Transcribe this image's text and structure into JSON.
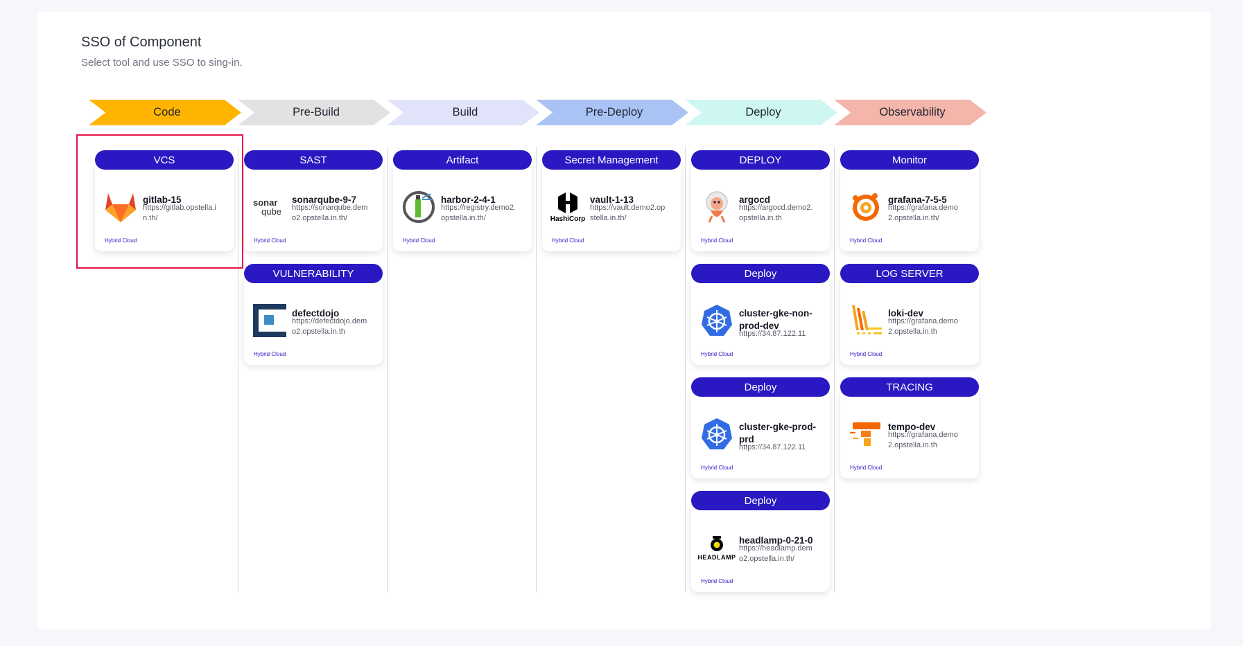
{
  "page": {
    "title": "SSO of Component",
    "subtitle": "Select tool and use SSO to sing-in."
  },
  "stages": [
    {
      "label": "Code",
      "color": "#ffb400"
    },
    {
      "label": "Pre-Build",
      "color": "#e2e2e2"
    },
    {
      "label": "Build",
      "color": "#e1e3fb"
    },
    {
      "label": "Pre-Deploy",
      "color": "#a9c3f5"
    },
    {
      "label": "Deploy",
      "color": "#cff7f2"
    },
    {
      "label": "Observability",
      "color": "#f4b5aa"
    }
  ],
  "colors": {
    "pill": "#2a19c2",
    "highlight": "#e5134b",
    "badge": "#2a19c2"
  },
  "columns": [
    {
      "groups": [
        {
          "category": "VCS",
          "tool": {
            "name": "gitlab-15",
            "url": "https://gitlab.opstella.in.th/",
            "badge": "Hybrid Cloud",
            "icon": "gitlab-icon"
          }
        }
      ]
    },
    {
      "groups": [
        {
          "category": "SAST",
          "tool": {
            "name": "sonarqube-9-7",
            "url": "https://sonarqube.demo2.opstella.in.th/",
            "badge": "Hybrid Cloud",
            "icon": "sonarqube-icon",
            "logo_text_1": "sonar",
            "logo_text_2": "qube"
          }
        },
        {
          "category": "VULNERABILITY",
          "tool": {
            "name": "defectdojo",
            "url": "https://defectdojo.demo2.opstella.in.th",
            "badge": "Hybrid Cloud",
            "icon": "defectdojo-icon"
          }
        }
      ]
    },
    {
      "groups": [
        {
          "category": "Artifact",
          "tool": {
            "name": "harbor-2-4-1",
            "url": "https://registry.demo2.opstella.in.th/",
            "badge": "Hybrid Cloud",
            "icon": "harbor-icon"
          }
        }
      ]
    },
    {
      "groups": [
        {
          "category": "Secret Management",
          "tool": {
            "name": "vault-1-13",
            "url": "https://vault.demo2.opstella.in.th/",
            "badge": "Hybrid Cloud",
            "icon": "hashicorp-vault-icon",
            "logo_text": "HashiCorp"
          }
        }
      ]
    },
    {
      "groups": [
        {
          "category": "DEPLOY",
          "tool": {
            "name": "argocd",
            "url": "https://argocd.demo2.opstella.in.th",
            "badge": "Hybrid Cloud",
            "icon": "argocd-icon"
          }
        },
        {
          "category": "Deploy",
          "tool": {
            "name": "cluster-gke-non-prod-dev",
            "url": "https://34.87.122.11",
            "badge": "Hybrid Cloud",
            "icon": "kubernetes-icon"
          }
        },
        {
          "category": "Deploy",
          "tool": {
            "name": "cluster-gke-prod-prd",
            "url": "https://34.87.122.11",
            "badge": "Hybrid Cloud",
            "icon": "kubernetes-icon"
          }
        },
        {
          "category": "Deploy",
          "tool": {
            "name": "headlamp-0-21-0",
            "url": "https://headlamp.demo2.opstella.in.th/",
            "badge": "Hybrid Cloud",
            "icon": "headlamp-icon",
            "logo_text": "HEADLAMP"
          }
        }
      ]
    },
    {
      "groups": [
        {
          "category": "Monitor",
          "tool": {
            "name": "grafana-7-5-5",
            "url": "https://grafana.demo2.opstella.in.th/",
            "badge": "Hybrid Cloud",
            "icon": "grafana-icon"
          }
        },
        {
          "category": "LOG SERVER",
          "tool": {
            "name": "loki-dev",
            "url": "https://grafana.demo2.opstella.in.th",
            "badge": "Hybrid Cloud",
            "icon": "loki-icon"
          }
        },
        {
          "category": "TRACING",
          "tool": {
            "name": "tempo-dev",
            "url": "https://grafana.demo2.opstella.in.th",
            "badge": "Hybrid Cloud",
            "icon": "tempo-icon"
          }
        }
      ]
    }
  ]
}
